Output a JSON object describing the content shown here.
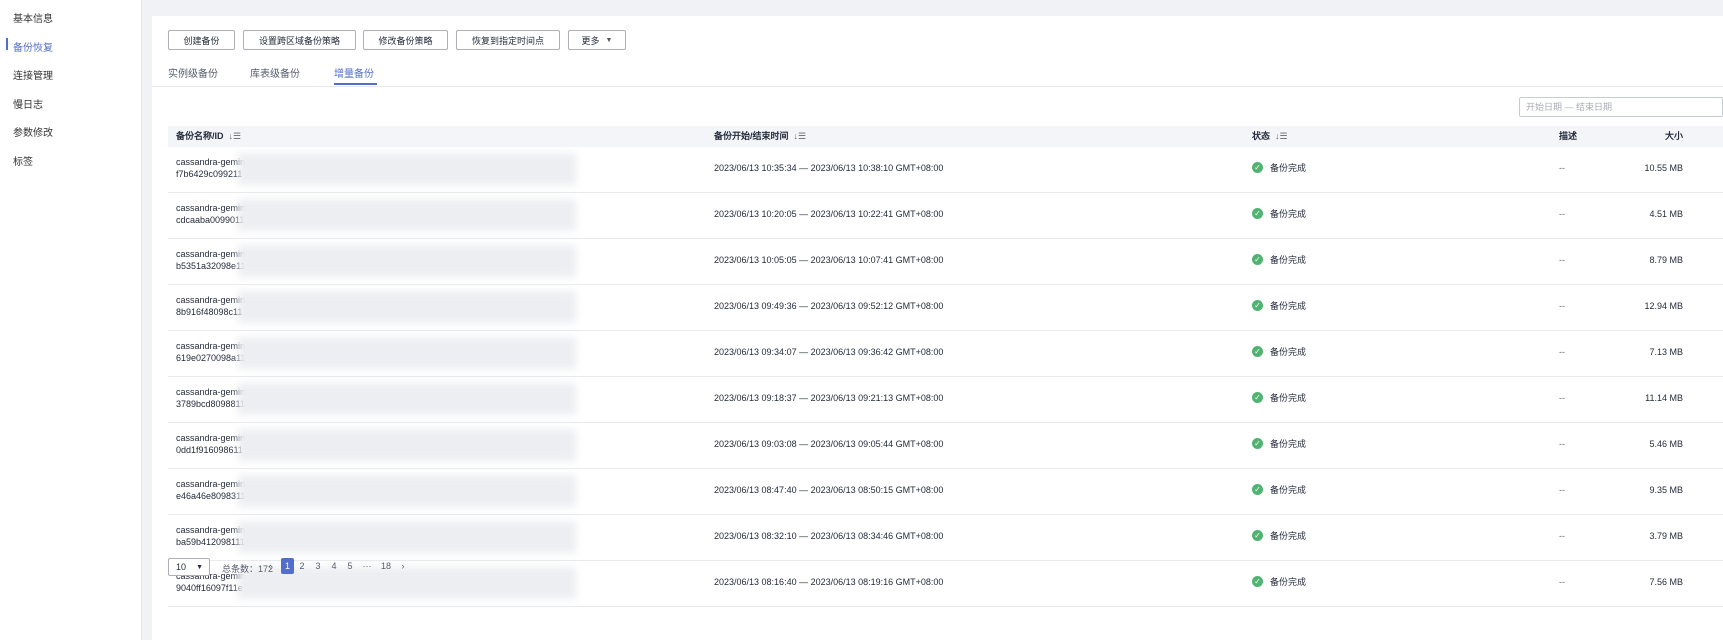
{
  "sidebar": {
    "items": [
      {
        "label": "基本信息"
      },
      {
        "label": "备份恢复"
      },
      {
        "label": "连接管理"
      },
      {
        "label": "慢日志"
      },
      {
        "label": "参数修改"
      },
      {
        "label": "标签"
      }
    ]
  },
  "toolbar": {
    "create_label": "创建备份",
    "cross_region_label": "设置跨区域备份策略",
    "modify_policy_label": "修改备份策略",
    "restore_label": "恢复到指定时间点",
    "more_label": "更多"
  },
  "tabs": [
    {
      "label": "实例级备份"
    },
    {
      "label": "库表级备份"
    },
    {
      "label": "增量备份"
    }
  ],
  "filter": {
    "date_placeholder": "开始日期 — 结束日期"
  },
  "table": {
    "columns": {
      "name": "备份名称/ID",
      "time": "备份开始/结束时间",
      "status": "状态",
      "size": "大小",
      "desc": "描述"
    },
    "rows": [
      {
        "name": "cassandra-gemin",
        "id": "f7b6429c099211",
        "time": "2023/06/13 10:35:34 — 2023/06/13 10:38:10 GMT+08:00",
        "status": "备份完成",
        "size": "10.55 MB",
        "desc": "--"
      },
      {
        "name": "cassandra-gemin",
        "id": "cdcaaba0099011",
        "time": "2023/06/13 10:20:05 — 2023/06/13 10:22:41 GMT+08:00",
        "status": "备份完成",
        "size": "4.51 MB",
        "desc": "--"
      },
      {
        "name": "cassandra-gemin",
        "id": "b5351a32098e11",
        "time": "2023/06/13 10:05:05 — 2023/06/13 10:07:41 GMT+08:00",
        "status": "备份完成",
        "size": "8.79 MB",
        "desc": "--"
      },
      {
        "name": "cassandra-gemin",
        "id": "8b916f48098c11",
        "time": "2023/06/13 09:49:36 — 2023/06/13 09:52:12 GMT+08:00",
        "status": "备份完成",
        "size": "12.94 MB",
        "desc": "--"
      },
      {
        "name": "cassandra-gemin",
        "id": "619e0270098a11",
        "time": "2023/06/13 09:34:07 — 2023/06/13 09:36:42 GMT+08:00",
        "status": "备份完成",
        "size": "7.13 MB",
        "desc": "--"
      },
      {
        "name": "cassandra-gemin",
        "id": "3789bcd8098811",
        "time": "2023/06/13 09:18:37 — 2023/06/13 09:21:13 GMT+08:00",
        "status": "备份完成",
        "size": "11.14 MB",
        "desc": "--"
      },
      {
        "name": "cassandra-gemin",
        "id": "0dd1f916098611",
        "time": "2023/06/13 09:03:08 — 2023/06/13 09:05:44 GMT+08:00",
        "status": "备份完成",
        "size": "5.46 MB",
        "desc": "--"
      },
      {
        "name": "cassandra-gemin",
        "id": "e46a46e8098311",
        "time": "2023/06/13 08:47:40 — 2023/06/13 08:50:15 GMT+08:00",
        "status": "备份完成",
        "size": "9.35 MB",
        "desc": "--"
      },
      {
        "name": "cassandra-gemin",
        "id": "ba59b412098111",
        "time": "2023/06/13 08:32:10 — 2023/06/13 08:34:46 GMT+08:00",
        "status": "备份完成",
        "size": "3.79 MB",
        "desc": "--"
      },
      {
        "name": "cassandra-gemin",
        "id": "9040ff16097f11e",
        "time": "2023/06/13 08:16:40 — 2023/06/13 08:19:16 GMT+08:00",
        "status": "备份完成",
        "size": "7.56 MB",
        "desc": "--"
      }
    ]
  },
  "pagination": {
    "page_size": "10",
    "total_label": "总条数：172",
    "prev": "‹",
    "pages": [
      "1",
      "2",
      "3",
      "4",
      "5"
    ],
    "ellipsis": "···",
    "last": "18",
    "next": "›",
    "current": "1"
  },
  "colors": {
    "accent": "#526ecc",
    "success": "#50b371"
  }
}
